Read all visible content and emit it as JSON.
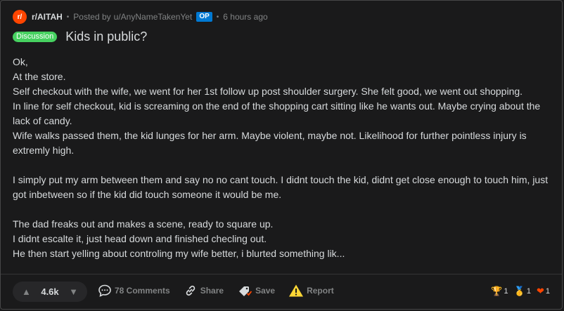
{
  "meta": {
    "subreddit_icon": "r/",
    "subreddit": "r/AITAH",
    "posted_by": "Posted by",
    "author": "u/AnyNameTakenYet",
    "op_badge": "OP",
    "time": "6 hours ago",
    "separator": "•"
  },
  "post": {
    "flair": "Discussion",
    "title": "Kids in public?",
    "body_lines": [
      "Ok,",
      "At the store.",
      "Self checkout with the wife, we went for her 1st follow up post shoulder surgery. She felt good, we went out shopping.",
      "In line for self checkout, kid is screaming on the end of the shopping cart sitting like he wants out. Maybe crying about the lack of candy.",
      "Wife walks passed them, the kid lunges for her arm. Maybe violent, maybe not. Likelihood for further pointless injury is extremly high.",
      "I simply put my arm between them and say no no cant touch. I didnt touch the kid, didnt get close enough to touch him, just got inbetween so if the kid did touch someone it would be me.",
      "The dad freaks out and makes a scene, ready to square up.",
      "I didnt escalte it, just head down and finished checling out.",
      "He then start yelling about controling my wife better, i blurted something lik..."
    ]
  },
  "footer": {
    "score": "4.6k",
    "upvote_icon": "upvote-icon",
    "downvote_icon": "downvote-icon",
    "comments": "78 Comments",
    "share": "Share",
    "save": "Save",
    "report": "Report",
    "awards": [
      {
        "icon": "trophy-icon",
        "count": "1"
      },
      {
        "icon": "medal-icon",
        "count": "1"
      },
      {
        "icon": "heart-icon",
        "count": "1"
      }
    ]
  },
  "colors": {
    "background": "#1a1a1b",
    "subreddit_icon": "#ff4500",
    "op_badge": "#0079d3",
    "flair": "#46d160",
    "report_icon": "#ffd635"
  }
}
